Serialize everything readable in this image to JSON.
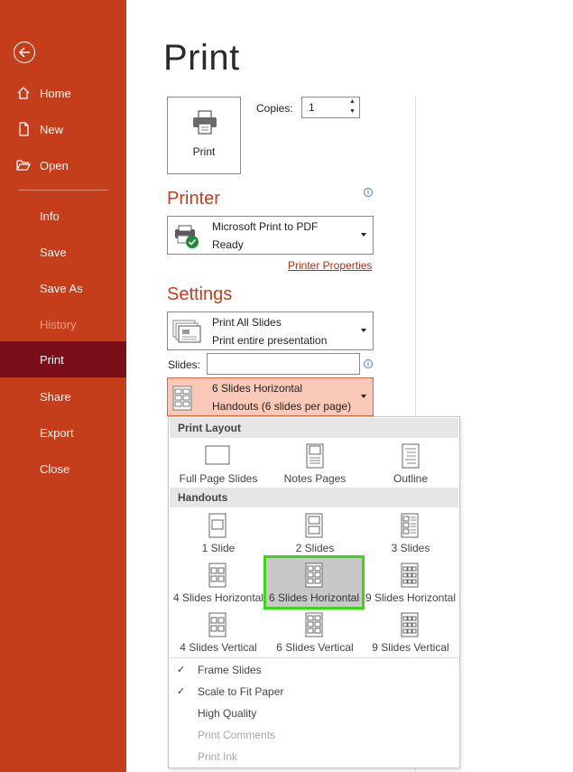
{
  "sidebar": {
    "items": [
      {
        "label": "Home",
        "icon": "home-icon"
      },
      {
        "label": "New",
        "icon": "new-document-icon"
      },
      {
        "label": "Open",
        "icon": "open-folder-icon"
      },
      {
        "label": "Info"
      },
      {
        "label": "Save"
      },
      {
        "label": "Save As"
      },
      {
        "label": "History"
      },
      {
        "label": "Print"
      },
      {
        "label": "Share"
      },
      {
        "label": "Export"
      },
      {
        "label": "Close"
      }
    ]
  },
  "page": {
    "title": "Print"
  },
  "print_button": {
    "label": "Print"
  },
  "copies": {
    "label": "Copies:",
    "value": "1"
  },
  "printer": {
    "heading": "Printer",
    "name": "Microsoft Print to PDF",
    "status": "Ready",
    "properties_link": "Printer Properties"
  },
  "settings": {
    "heading": "Settings",
    "range": {
      "line1": "Print All Slides",
      "line2": "Print entire presentation"
    },
    "slides_label": "Slides:",
    "slides_value": "",
    "layout": {
      "line1": "6 Slides Horizontal",
      "line2": "Handouts (6 slides per page)"
    }
  },
  "popup": {
    "print_layout_header": "Print Layout",
    "print_layout_options": [
      "Full Page Slides",
      "Notes Pages",
      "Outline"
    ],
    "handouts_header": "Handouts",
    "handouts_options": [
      "1 Slide",
      "2 Slides",
      "3 Slides",
      "4 Slides Horizontal",
      "6 Slides Horizontal",
      "9 Slides Horizontal",
      "4 Slides Vertical",
      "6 Slides Vertical",
      "9 Slides Vertical"
    ],
    "selected": "6 Slides Horizontal",
    "menu_options": [
      {
        "label": "Frame Slides",
        "checked": true,
        "enabled": true
      },
      {
        "label": "Scale to Fit Paper",
        "checked": true,
        "enabled": true
      },
      {
        "label": "High Quality",
        "checked": false,
        "enabled": true
      },
      {
        "label": "Print Comments",
        "checked": false,
        "enabled": false
      },
      {
        "label": "Print Ink",
        "checked": false,
        "enabled": false
      }
    ]
  },
  "colors": {
    "sidebar_bg": "#c43e1c",
    "sidebar_selected": "#7a0f1a",
    "accent": "#c43e1c",
    "selection_highlight": "#3cd618"
  }
}
